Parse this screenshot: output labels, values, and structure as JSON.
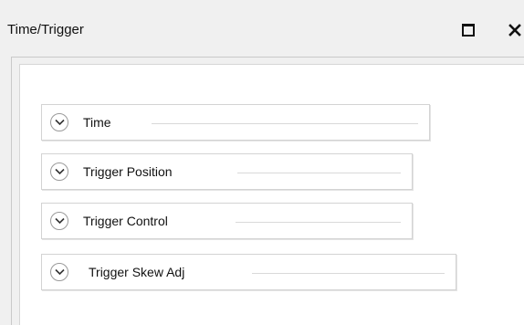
{
  "window": {
    "title": "Time/Trigger",
    "maximize_icon": "maximize-icon",
    "close_icon": "close-icon"
  },
  "groups": [
    {
      "label": "Time",
      "icon": "chevron-down-icon",
      "expanded": false
    },
    {
      "label": "Trigger Position",
      "icon": "chevron-down-icon",
      "expanded": false
    },
    {
      "label": "Trigger Control",
      "icon": "chevron-down-icon",
      "expanded": false
    },
    {
      "label": "Trigger Skew Adj",
      "icon": "chevron-down-icon",
      "expanded": false
    }
  ],
  "colors": {
    "window_bg": "#f0f0f0",
    "panel_bg": "#ffffff",
    "border": "#d3d3d3",
    "text": "#111111"
  }
}
